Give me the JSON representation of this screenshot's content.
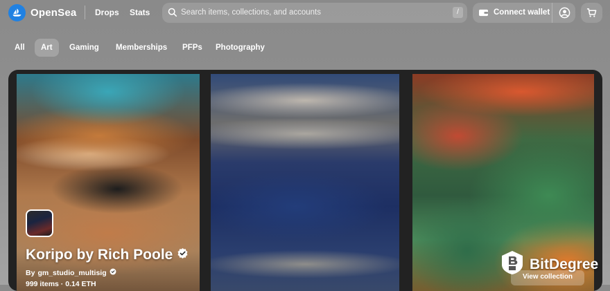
{
  "header": {
    "brand": "OpenSea",
    "nav": [
      "Drops",
      "Stats"
    ],
    "search_placeholder": "Search items, collections, and accounts",
    "search_shortcut": "/",
    "connect_wallet": "Connect wallet"
  },
  "category_tabs": {
    "items": [
      "All",
      "Art",
      "Gaming",
      "Memberships",
      "PFPs",
      "Photography"
    ],
    "selected": "Art"
  },
  "featured": {
    "title": "Koripo by Rich Poole",
    "by_prefix": "By",
    "creator": "gm_studio_multisig",
    "stats": "999 items · 0.14 ETH",
    "cta": "View collection"
  },
  "watermark": {
    "text": "BitDegree"
  },
  "colors": {
    "brand_blue": "#2081e2",
    "page_bg": "#8f8f8f"
  },
  "icons": [
    "opensea-logo-icon",
    "search-icon",
    "wallet-icon",
    "profile-icon",
    "cart-icon",
    "verified-badge-icon",
    "bitdegree-logo-icon"
  ]
}
